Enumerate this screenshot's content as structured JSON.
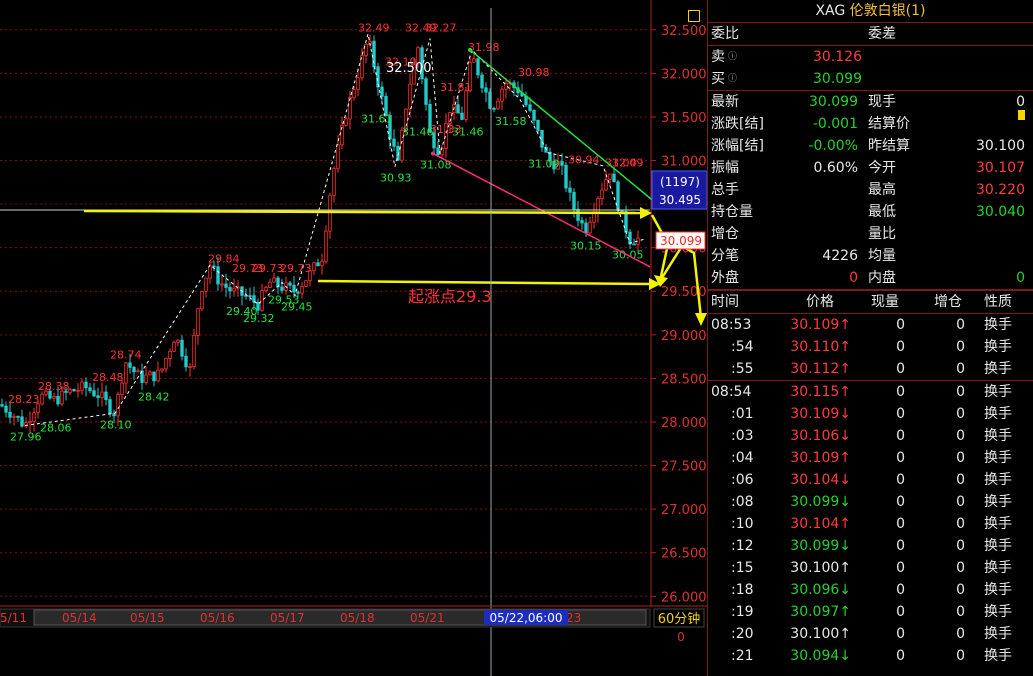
{
  "panel": {
    "symbol": "XAG",
    "name": "伦敦白银(1)",
    "weibi_label": "委比",
    "weicha_label": "委差",
    "sell_label": "卖",
    "sell_value": "30.126",
    "buy_label": "买",
    "buy_value": "30.099",
    "stats": [
      {
        "l1": "最新",
        "v1": "30.099",
        "c1": "green",
        "l2": "现手",
        "v2": "0",
        "c2": "white"
      },
      {
        "l1": "涨跌[结]",
        "v1": "-0.001",
        "c1": "green",
        "l2": "结算价",
        "v2": "",
        "c2": "white"
      },
      {
        "l1": "涨幅[结]",
        "v1": "-0.00%",
        "c1": "green",
        "l2": "昨结算",
        "v2": "30.100",
        "c2": "white"
      },
      {
        "l1": "振幅",
        "v1": "0.60%",
        "c1": "white",
        "l2": "今开",
        "v2": "30.107",
        "c2": "red"
      },
      {
        "l1": "总手",
        "v1": "",
        "c1": "white",
        "l2": "最高",
        "v2": "30.220",
        "c2": "red"
      },
      {
        "l1": "持仓量",
        "v1": "",
        "c1": "white",
        "l2": "最低",
        "v2": "30.040",
        "c2": "green"
      },
      {
        "l1": "增仓",
        "v1": "",
        "c1": "white",
        "l2": "量比",
        "v2": "",
        "c2": "white"
      },
      {
        "l1": "分笔",
        "v1": "4226",
        "c1": "white",
        "l2": "均量",
        "v2": "",
        "c2": "white"
      },
      {
        "l1": "外盘",
        "v1": "0",
        "c1": "red",
        "l2": "内盘",
        "v2": "0",
        "c2": "green"
      }
    ],
    "ticks_header": [
      "时间",
      "价格",
      "现量",
      "增仓",
      "性质"
    ],
    "ticks": [
      {
        "t": "08:53",
        "p": "30.109↑",
        "c": "red",
        "q": "0",
        "z": "0",
        "x": "换手"
      },
      {
        "t": ":54",
        "p": "30.110↑",
        "c": "red",
        "q": "0",
        "z": "0",
        "x": "换手"
      },
      {
        "t": ":55",
        "p": "30.112↑",
        "c": "red",
        "q": "0",
        "z": "0",
        "x": "换手"
      },
      {
        "t": "08:54",
        "p": "30.115↑",
        "c": "red",
        "q": "0",
        "z": "0",
        "x": "换手"
      },
      {
        "t": ":01",
        "p": "30.109↓",
        "c": "red",
        "q": "0",
        "z": "0",
        "x": "换手"
      },
      {
        "t": ":03",
        "p": "30.106↓",
        "c": "red",
        "q": "0",
        "z": "0",
        "x": "换手"
      },
      {
        "t": ":04",
        "p": "30.109↑",
        "c": "red",
        "q": "0",
        "z": "0",
        "x": "换手"
      },
      {
        "t": ":06",
        "p": "30.104↓",
        "c": "red",
        "q": "0",
        "z": "0",
        "x": "换手"
      },
      {
        "t": ":08",
        "p": "30.099↓",
        "c": "green",
        "q": "0",
        "z": "0",
        "x": "换手"
      },
      {
        "t": ":10",
        "p": "30.104↑",
        "c": "red",
        "q": "0",
        "z": "0",
        "x": "换手"
      },
      {
        "t": ":12",
        "p": "30.099↓",
        "c": "green",
        "q": "0",
        "z": "0",
        "x": "换手"
      },
      {
        "t": ":15",
        "p": "30.100↑",
        "c": "white",
        "q": "0",
        "z": "0",
        "x": "换手"
      },
      {
        "t": ":18",
        "p": "30.096↓",
        "c": "green",
        "q": "0",
        "z": "0",
        "x": "换手"
      },
      {
        "t": ":19",
        "p": "30.097↑",
        "c": "green",
        "q": "0",
        "z": "0",
        "x": "换手"
      },
      {
        "t": ":20",
        "p": "30.100↑",
        "c": "white",
        "q": "0",
        "z": "0",
        "x": "换手"
      },
      {
        "t": ":21",
        "p": "30.094↓",
        "c": "green",
        "q": "0",
        "z": "0",
        "x": "换手"
      }
    ]
  },
  "chart_data": {
    "type": "candlestick",
    "timeframe": "60分钟",
    "ylim": [
      25.9,
      32.75
    ],
    "yticks": [
      "32.500",
      "32.000",
      "31.500",
      "31.000",
      "30.500",
      "30.000",
      "29.500",
      "29.000",
      "28.500",
      "28.000",
      "27.500",
      "27.000",
      "26.500",
      "26.000"
    ],
    "ytick_values": [
      32.5,
      32.0,
      31.5,
      31.0,
      30.5,
      30.0,
      29.5,
      29.0,
      28.5,
      28.0,
      27.5,
      27.0,
      26.5,
      26.0
    ],
    "xticks": [
      "5/11",
      "05/14",
      "05/15",
      "05/16",
      "05/17",
      "05/18",
      "05/21",
      "05/22",
      "23"
    ],
    "cursor_time": "05/22,06:00",
    "cursor_price": "32.500",
    "last_price": "30.099",
    "price_box": "30.495",
    "price_box_count": "(1197)",
    "start_annotation": "起涨点29.3",
    "peak_labels": [
      "28.23",
      "28.38",
      "28.48",
      "28.74",
      "29.84",
      "29.73",
      "29.73",
      "29.73",
      "32.49",
      "32.10",
      "32.49",
      "32.27",
      "31.81",
      "31.98",
      "30.98",
      "30.94",
      "31.00",
      "32.49",
      "31.33"
    ],
    "trough_labels": [
      "27.96",
      "28.06",
      "28.10",
      "28.42",
      "29.40",
      "29.32",
      "29.53",
      "29.45",
      "31.61",
      "30.93",
      "31.46",
      "31.08",
      "31.46",
      "31.58",
      "31.09",
      "30.15",
      "30.05"
    ],
    "bottom_value": "0"
  }
}
